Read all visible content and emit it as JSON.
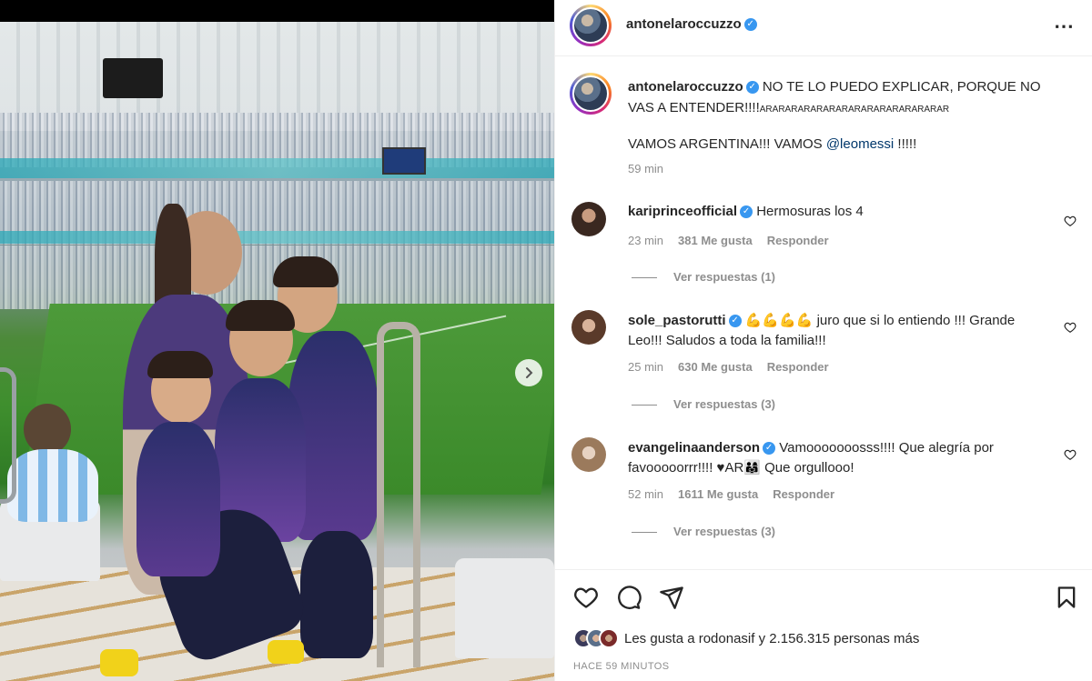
{
  "post": {
    "author": "antonelaroccuzzo",
    "verified_icon": "verified-badge-icon",
    "caption_main": "NO TE LO PUEDO EXPLICAR, PORQUE NO VAS A ENTENDER!!!!",
    "caption_tail": "ARARARARARARARARARARARARARARAR",
    "caption_line2_prefix": "VAMOS ARGENTINA!!! VAMOS ",
    "caption_mention": "@leomessi",
    "caption_line2_suffix": " !!!!!",
    "caption_time": "59 min"
  },
  "comments": [
    {
      "user": "kariprinceofficial",
      "text": "Hermosuras los 4",
      "time": "23 min",
      "likes": "381 Me gusta",
      "reply": "Responder",
      "view_replies": "Ver respuestas (1)"
    },
    {
      "user": "sole_pastorutti",
      "text": "💪💪💪💪 juro que si lo entiendo !!! Grande Leo!!! Saludos a toda la familia!!!",
      "time": "25 min",
      "likes": "630 Me gusta",
      "reply": "Responder",
      "view_replies": "Ver respuestas (3)"
    },
    {
      "user": "evangelinaanderson",
      "text": "Vamooooooosss!!!! Que alegría por favooooorrr!!!! ♥AR👨‍👩‍👧 Que orgullooo!",
      "time": "52 min",
      "likes": "1611 Me gusta",
      "reply": "Responder",
      "view_replies": "Ver respuestas (3)"
    }
  ],
  "footer": {
    "likes_text": "Les gusta a rodonasif y 2.156.315 personas más",
    "posted_ago": "HACE 59 MINUTOS"
  },
  "colors": {
    "link": "#00376b",
    "verified": "#3897f0",
    "muted": "#8e8e8e"
  }
}
